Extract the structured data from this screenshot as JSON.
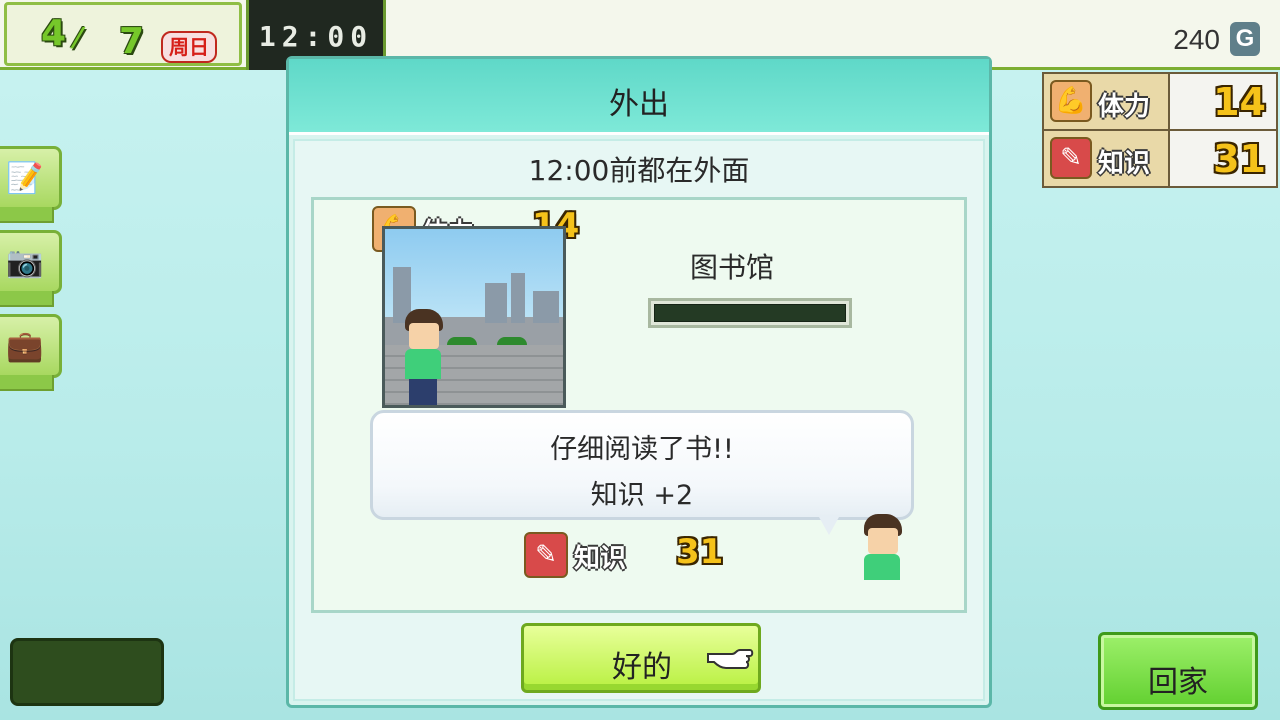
{
  "header": {
    "month": "4",
    "day": "7",
    "weekday": "周日",
    "time": "12:00",
    "money": "240",
    "currency_icon": "G"
  },
  "stats": [
    {
      "name": "体力",
      "value": "14",
      "icon": "stamina-icon"
    },
    {
      "name": "知识",
      "value": "31",
      "icon": "knowledge-icon"
    }
  ],
  "side_menu": [
    {
      "icon": "notebook-icon"
    },
    {
      "icon": "camera-icon"
    },
    {
      "icon": "briefcase-icon"
    }
  ],
  "dialog": {
    "title": "外出",
    "subtitle": "12:00前都在外面",
    "stamina": {
      "name": "体力",
      "value": "14"
    },
    "location": "图书馆",
    "progress": 0,
    "message_line1": "仔细阅读了书!!",
    "message_line2": "知识 +2",
    "knowledge": {
      "name": "知识",
      "value": "31"
    },
    "ok_label": "好的"
  },
  "home_button": "回家",
  "colors": {
    "accent_green": "#76c72a",
    "gold_number": "#f5c21a",
    "dialog_teal": "#5fd8c8"
  }
}
